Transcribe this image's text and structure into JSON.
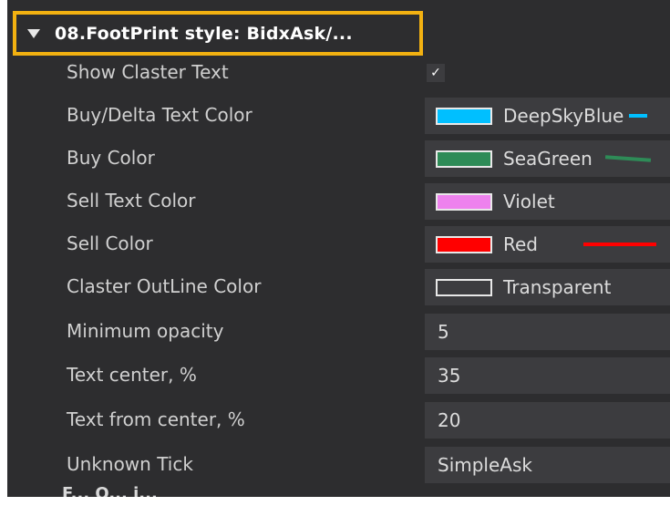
{
  "group": {
    "title": "08.FootPrint style: BidxAsk/..."
  },
  "rows": [
    {
      "label": "Show Claster Text",
      "type": "checkbox",
      "checked": true,
      "check_glyph": "✓"
    },
    {
      "label": "Buy/Delta Text Color",
      "type": "color",
      "color_name": "DeepSkyBlue",
      "color": "#00bfff"
    },
    {
      "label": "Buy Color",
      "type": "color",
      "color_name": "SeaGreen",
      "color": "#2e8b57"
    },
    {
      "label": "Sell Text Color",
      "type": "color",
      "color_name": "Violet",
      "color": "#ee82ee"
    },
    {
      "label": "Sell Color",
      "type": "color",
      "color_name": "Red",
      "color": "#ff0000"
    },
    {
      "label": "Claster OutLine Color",
      "type": "color",
      "color_name": "Transparent",
      "color": "transparent"
    },
    {
      "label": "Minimum opacity",
      "type": "text",
      "value": "5"
    },
    {
      "label": "Text center, %",
      "type": "text",
      "value": "35"
    },
    {
      "label": "Text from center, %",
      "type": "text",
      "value": "20"
    },
    {
      "label": "Unknown Tick",
      "type": "text",
      "value": "SimpleAsk"
    }
  ],
  "next_group": {
    "title": "F... O... i..."
  },
  "colors": {
    "panel_bg": "#2d2d2f",
    "cell_bg": "#3c3c3f",
    "highlight": "#f2b111"
  }
}
